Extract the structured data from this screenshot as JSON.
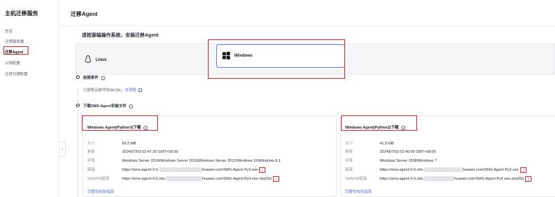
{
  "sidebar": {
    "title": "主机迁移服务",
    "items": [
      {
        "label": "总览"
      },
      {
        "label": "迁移服务器"
      },
      {
        "label": "迁移Agent"
      },
      {
        "label": "公网配置"
      },
      {
        "label": "迁移代理配置"
      }
    ],
    "collapse_glyph": "‹"
  },
  "header": {
    "title": "迁移Agent"
  },
  "main": {
    "section_title": "请按源端操作系统，安装迁移Agent",
    "os_options": [
      {
        "label": "Linux",
        "icon": "linux-icon"
      },
      {
        "label": "Windows",
        "icon": "windows-icon",
        "selected": true
      }
    ],
    "prereq": {
      "title": "前提条件",
      "text": "已获取云账号的AK/SK。",
      "link": "去获取"
    },
    "download": {
      "title": "下载SMS-Agent安装文件"
    },
    "cards": [
      {
        "title": "Windows Agent(Python3)下载",
        "size_label": "大小",
        "size": "69.2 MB",
        "update_label": "更新",
        "update": "2024/07/03 02:47:20 GMT+08:00",
        "env_label": "环境",
        "env": "Windows Server 2019/Windows Server 2016/Windows Server 2012/Windows 10/Windows 8.1",
        "link_label": "链接",
        "link_prefix": "https://sms-agent-3-0.",
        "link_suffix": "huawei.com/SMS-Agent-Py3.exe",
        "sha_label": "SHA256链接",
        "sha_prefix": "https://sms-agent-3-0.obs.",
        "sha_suffix": "huawei.com/SMS-Agent-Py3.exe.sha256",
        "footer": "完整性校验指南"
      },
      {
        "title": "Windows Agent(Python2)下载",
        "size_label": "大小",
        "size": "41.8 MB",
        "update_label": "更新",
        "update": "2024/07/03 02:46:59 GMT+08:00",
        "env_label": "环境",
        "env": "Windows Server 2008/Windows 7",
        "link_label": "链接",
        "link_prefix": "https://sms-agent-3-0.obs.",
        "link_suffix": "huawei.com/SMS-Agent-Py2.exe",
        "sha_label": "SHA256链接",
        "sha_prefix": "https://sms-agent-3-0.obs.",
        "sha_suffix": "huawei.com/SMS-Agent-Py2.exe.sha256",
        "footer": "完整性校验指南"
      }
    ],
    "download_glyph": "⤓",
    "help_glyph": "?"
  },
  "colors": {
    "highlight": "#e02020",
    "link": "#526ecc",
    "selected_border": "#5e7ce0"
  }
}
